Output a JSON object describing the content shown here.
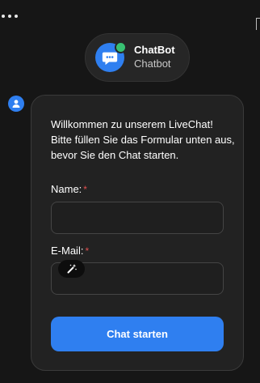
{
  "header": {
    "bot_name": "ChatBot",
    "bot_subtitle": "Chatbot",
    "status": "online"
  },
  "icons": {
    "menu": "more-dots-icon",
    "bot_avatar": "chat-bubble-icon",
    "user_avatar": "user-icon",
    "autofill": "magic-wand-icon"
  },
  "form": {
    "welcome_text": "Willkommen zu unserem LiveChat! Bitte füllen Sie das Formular unten aus, bevor Sie den Chat starten.",
    "name_label": "Name:",
    "name_required": "*",
    "name_value": "",
    "email_label": "E-Mail:",
    "email_required": "*",
    "email_value": "",
    "submit_label": "Chat starten"
  },
  "colors": {
    "accent": "#2f7ff0",
    "online": "#38c172",
    "required": "#e05050",
    "background": "#161616",
    "card": "#222222"
  }
}
